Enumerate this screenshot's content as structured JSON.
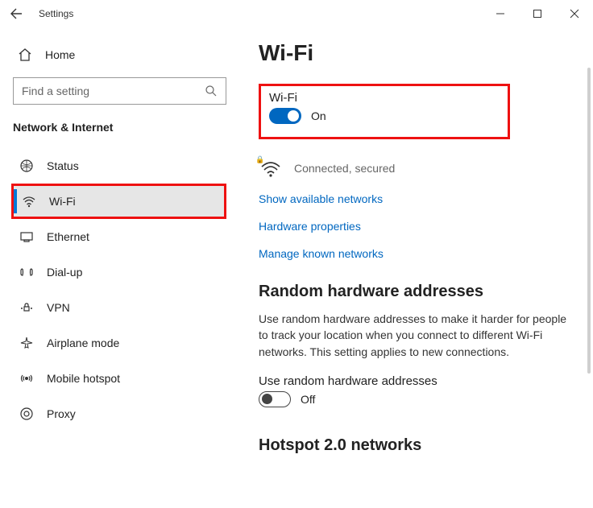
{
  "titlebar": {
    "title": "Settings"
  },
  "sidebar": {
    "home": "Home",
    "search_placeholder": "Find a setting",
    "category": "Network & Internet",
    "items": [
      {
        "label": "Status"
      },
      {
        "label": "Wi-Fi"
      },
      {
        "label": "Ethernet"
      },
      {
        "label": "Dial-up"
      },
      {
        "label": "VPN"
      },
      {
        "label": "Airplane mode"
      },
      {
        "label": "Mobile hotspot"
      },
      {
        "label": "Proxy"
      }
    ]
  },
  "main": {
    "heading": "Wi-Fi",
    "wifi_section_label": "Wi-Fi",
    "wifi_state": "On",
    "status_text": "Connected, secured",
    "links": {
      "show_networks": "Show available networks",
      "hardware_props": "Hardware properties",
      "manage_known": "Manage known networks"
    },
    "random_heading": "Random hardware addresses",
    "random_body": "Use random hardware addresses to make it harder for people to track your location when you connect to different Wi-Fi networks. This setting applies to new connections.",
    "random_toggle_label": "Use random hardware addresses",
    "random_state": "Off",
    "hotspot_heading": "Hotspot 2.0 networks"
  }
}
